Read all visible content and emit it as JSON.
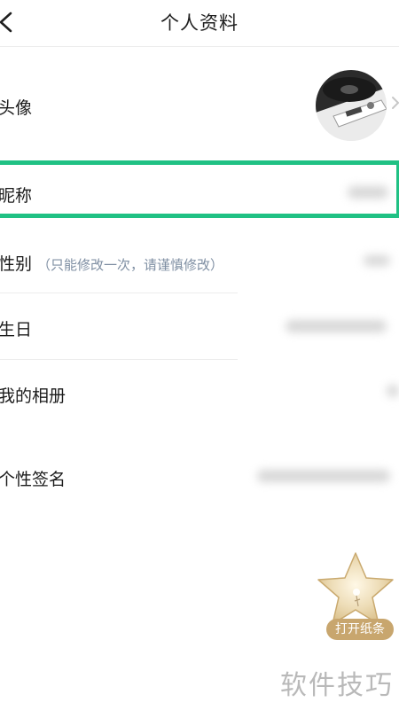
{
  "header": {
    "title": "个人资料"
  },
  "rows": {
    "avatar": {
      "label": "头像"
    },
    "nickname": {
      "label": "昵称"
    },
    "gender": {
      "label": "性别",
      "hint": "（只能修改一次，请谨慎修改）"
    },
    "birthday": {
      "label": "生日"
    },
    "album": {
      "label": "我的相册"
    },
    "signature": {
      "label": "个性签名"
    }
  },
  "floating": {
    "label": "打开纸条"
  },
  "watermark": "软件技巧",
  "colors": {
    "highlight": "#20c184",
    "hint": "#7f8fa3",
    "badge": "#c8a66e"
  }
}
